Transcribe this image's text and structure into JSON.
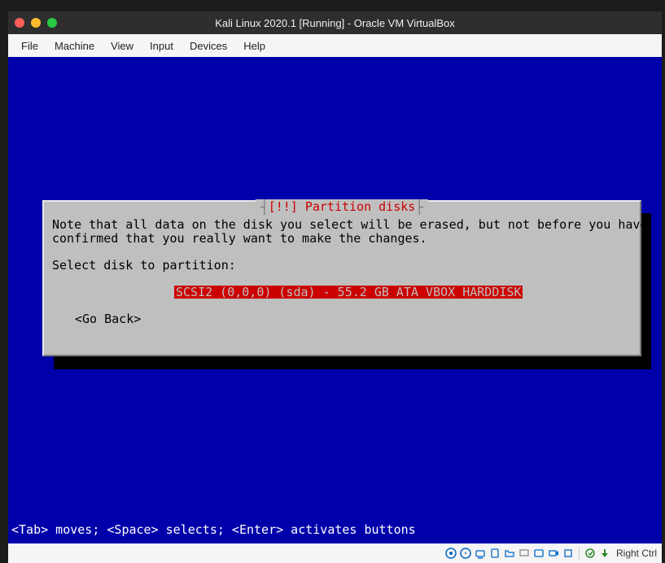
{
  "titlebar": {
    "title": "Kali Linux 2020.1 [Running] - Oracle VM VirtualBox"
  },
  "menubar": [
    "File",
    "Machine",
    "View",
    "Input",
    "Devices",
    "Help"
  ],
  "dialog": {
    "title": "[!!] Partition disks",
    "note_line1": "Note that all data on the disk you select will be erased, but not before you have",
    "note_line2": "confirmed that you really want to make the changes.",
    "prompt": "Select disk to partition:",
    "disk_option": "SCSI2 (0,0,0) (sda) - 55.2 GB ATA VBOX HARDDISK",
    "go_back": "<Go Back>"
  },
  "hint": "<Tab> moves; <Space> selects; <Enter> activates buttons",
  "statusbar": {
    "host_key": "Right Ctrl",
    "icons": [
      "hard-disk-icon",
      "optical-drive-icon",
      "network-icon",
      "usb-icon",
      "shared-folder-icon",
      "display-icon",
      "audio-icon",
      "recording-icon",
      "cpu-icon",
      "mouse-integration-icon",
      "keyboard-icon"
    ]
  }
}
